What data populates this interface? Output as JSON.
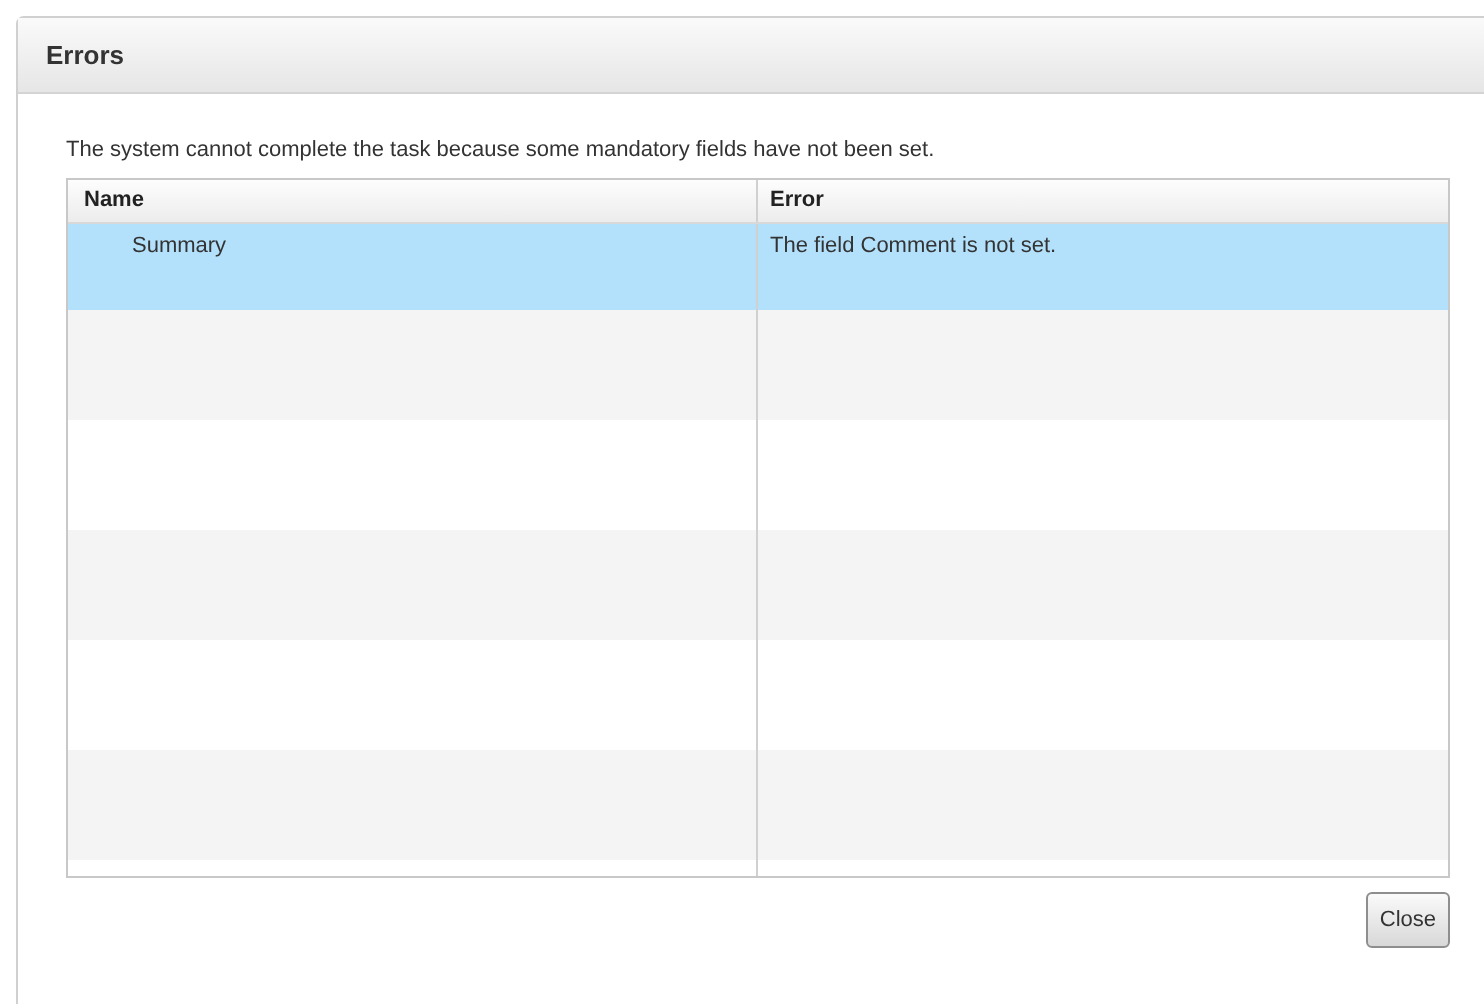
{
  "dialog": {
    "title": "Errors",
    "message": "The system cannot complete the task because some mandatory fields have not been set.",
    "table": {
      "columns": [
        "Name",
        "Error"
      ],
      "rows": [
        {
          "cells": [
            "Summary",
            "The field Comment is not set."
          ],
          "selected": true
        }
      ]
    },
    "buttons": [
      "Close"
    ]
  }
}
